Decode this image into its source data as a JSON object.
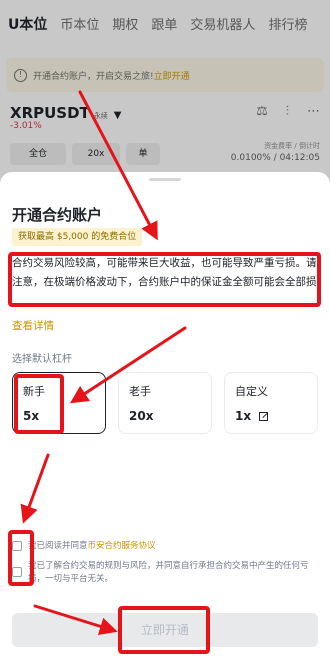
{
  "background": {
    "tabs": [
      "U本位",
      "币本位",
      "期权",
      "跟单",
      "交易机器人",
      "排行榜"
    ],
    "notice": {
      "text": "开通合约账户，开启交易之旅!",
      "link": "立即开通"
    },
    "pair": {
      "symbol": "XRPUSDT",
      "tag": "永续",
      "change": "-3.01%"
    },
    "chips": [
      "全仓",
      "20x",
      "单"
    ],
    "funding": {
      "label": "资金费率 / 倒计时",
      "value": "0.0100% / 04:12:05"
    }
  },
  "sheet": {
    "title": "开通合约账户",
    "promo": "获取最高 $5,000 的免费合位",
    "risk_text": "合约交易风险较高，可能带来巨大收益，也可能导致严重亏损。请注意，在极端价格波动下，合约账户中的保证金全额可能会全部损损",
    "details_link": "查看详情",
    "leverage_label": "选择默认杠杆",
    "options": [
      {
        "name": "新手",
        "lev": "5x"
      },
      {
        "name": "老手",
        "lev": "20x"
      },
      {
        "name": "自定义",
        "lev": "1x"
      }
    ],
    "agree1_text": "我已阅读并同意",
    "agree1_link": "币安合约服务协议",
    "agree2_text": "我已了解合约交易的规则与风险，并同意自行承担合约交易中产生的任何亏损，一切与平台无关。",
    "open_button": "立即开通"
  },
  "colors": {
    "annotation_red": "#e5141b",
    "accent": "#c99400",
    "negative": "#d6304a"
  }
}
